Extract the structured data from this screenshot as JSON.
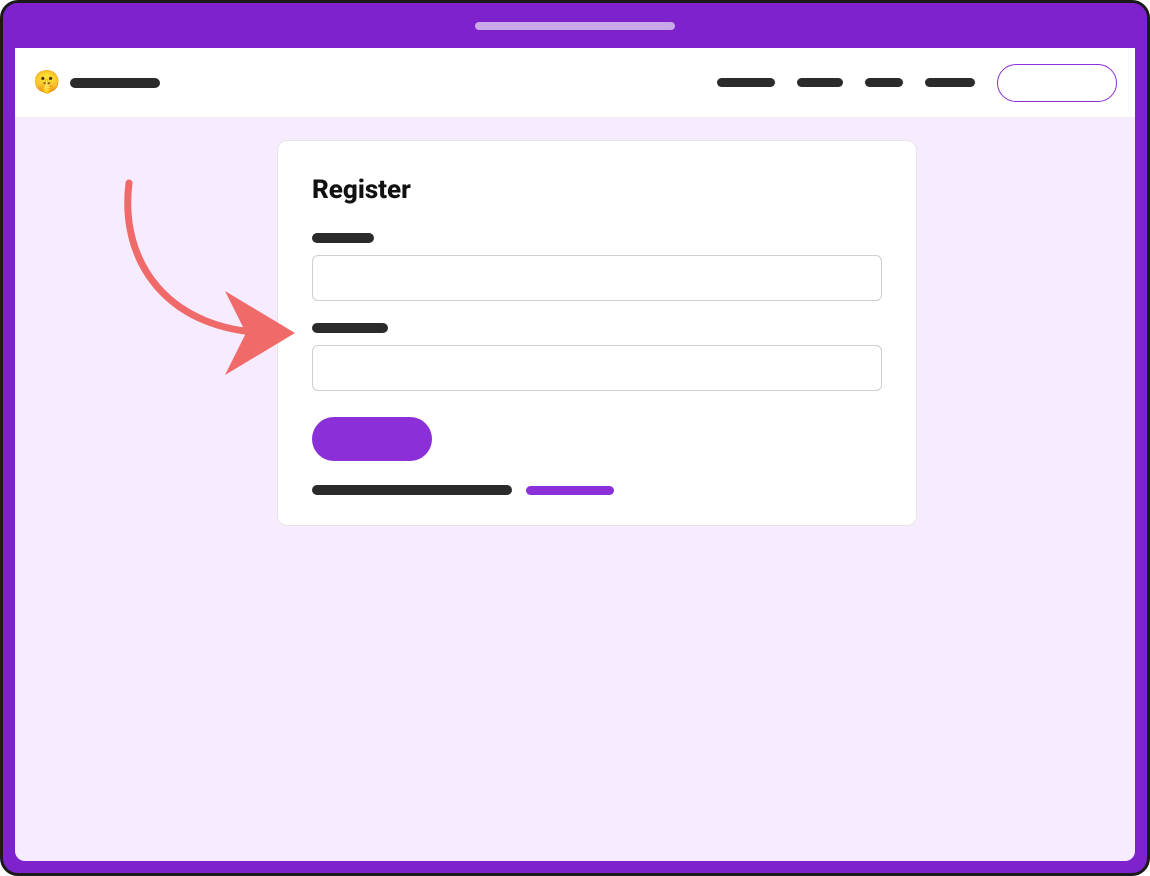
{
  "header": {
    "emoji": "🤫",
    "brand_label": "",
    "nav": {
      "link1": "",
      "link2": "",
      "link3": "",
      "link4": ""
    },
    "cta_label": ""
  },
  "register": {
    "title": "Register",
    "field1_label": "",
    "field1_value": "",
    "field2_label": "",
    "field2_value": "",
    "submit_label": "",
    "footer_text": "",
    "footer_link_label": ""
  },
  "colors": {
    "purple": "#7e22ce",
    "purple_light": "#f7ecff",
    "accent": "#8b2fd8",
    "arrow": "#f06a6a"
  }
}
